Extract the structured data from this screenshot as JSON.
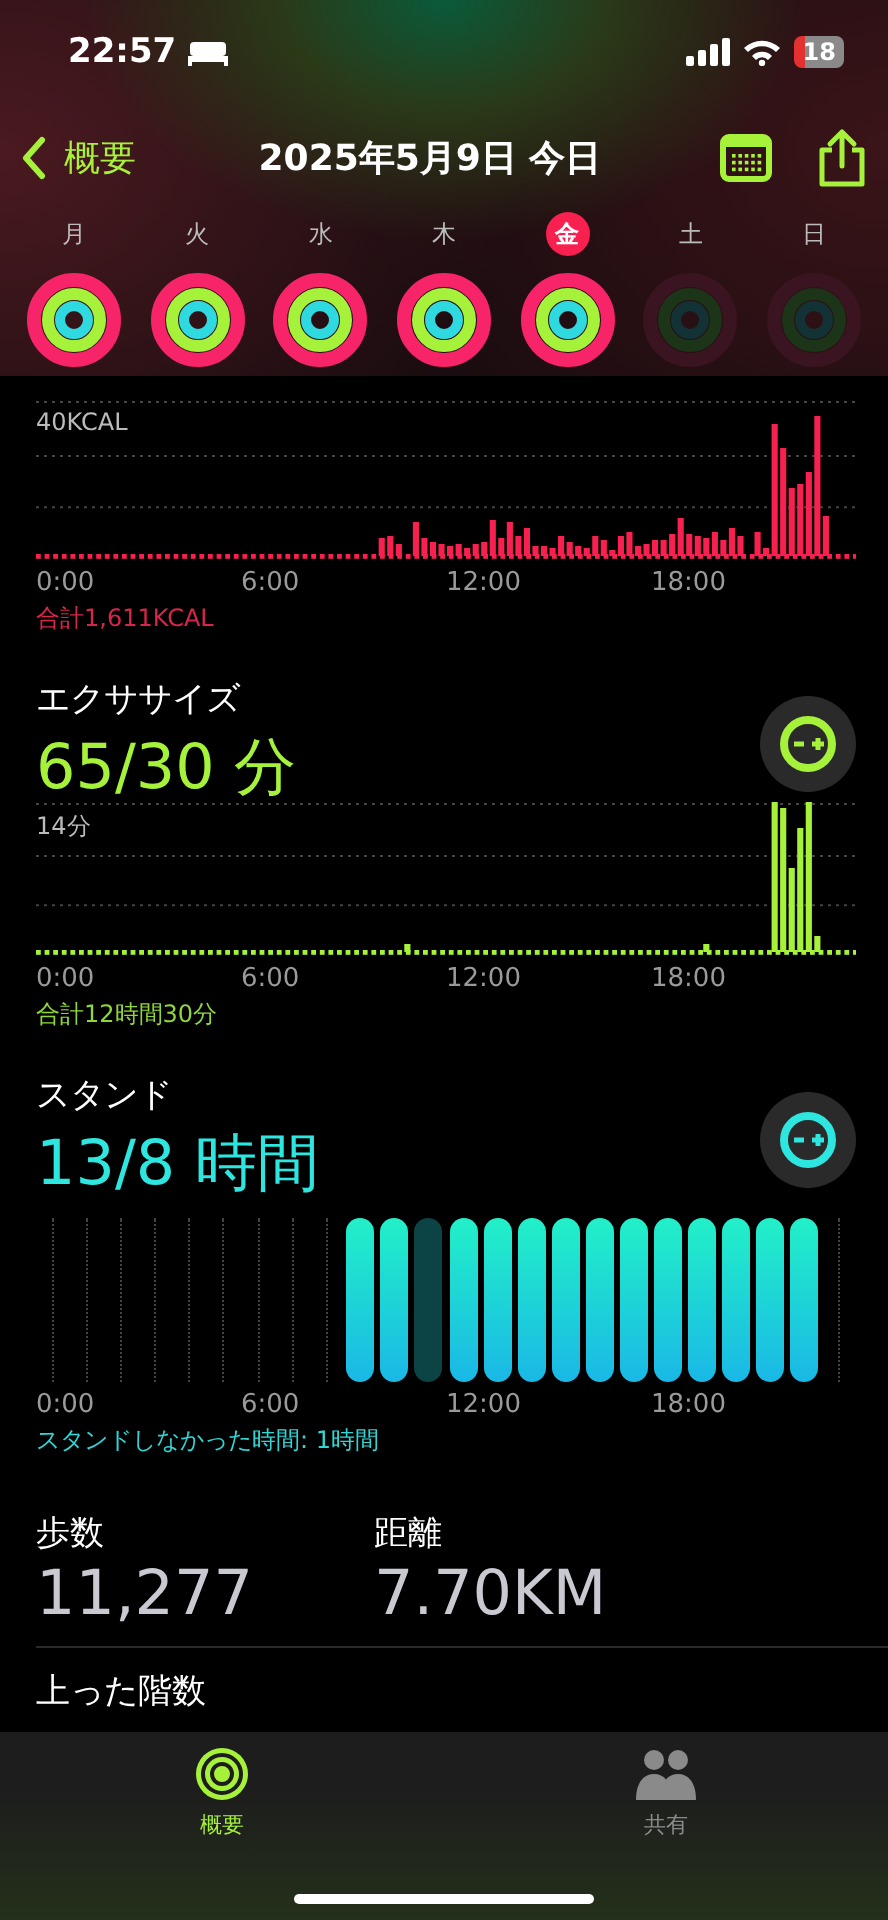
{
  "status_bar": {
    "time": "22:57",
    "battery": "18"
  },
  "nav": {
    "back": "概要",
    "title": "2025年5月9日 今日"
  },
  "days": [
    {
      "label": "月",
      "selected": false,
      "active": true
    },
    {
      "label": "火",
      "selected": false,
      "active": true
    },
    {
      "label": "水",
      "selected": false,
      "active": true
    },
    {
      "label": "木",
      "selected": false,
      "active": true
    },
    {
      "label": "金",
      "selected": true,
      "active": true
    },
    {
      "label": "土",
      "selected": false,
      "active": false
    },
    {
      "label": "日",
      "selected": false,
      "active": false
    }
  ],
  "move": {
    "y_label": "40KCAL",
    "x_labels": [
      "0:00",
      "6:00",
      "12:00",
      "18:00"
    ],
    "total": "合計1,611KCAL"
  },
  "exercise": {
    "title": "エクササイズ",
    "value": "65/30 分",
    "y_label": "14分",
    "x_labels": [
      "0:00",
      "6:00",
      "12:00",
      "18:00"
    ],
    "total": "合計12時間30分"
  },
  "stand": {
    "title": "スタンド",
    "value": "13/8 時間",
    "x_labels": [
      "0:00",
      "6:00",
      "12:00",
      "18:00"
    ],
    "caption": "スタンドしなかった時間: 1時間",
    "hours": [
      {
        "kind": "empty"
      },
      {
        "kind": "empty"
      },
      {
        "kind": "empty"
      },
      {
        "kind": "empty"
      },
      {
        "kind": "empty"
      },
      {
        "kind": "empty"
      },
      {
        "kind": "empty"
      },
      {
        "kind": "empty"
      },
      {
        "kind": "empty"
      },
      {
        "kind": "stood"
      },
      {
        "kind": "stood"
      },
      {
        "kind": "missed"
      },
      {
        "kind": "stood"
      },
      {
        "kind": "stood"
      },
      {
        "kind": "stood"
      },
      {
        "kind": "stood"
      },
      {
        "kind": "stood"
      },
      {
        "kind": "stood"
      },
      {
        "kind": "stood"
      },
      {
        "kind": "stood"
      },
      {
        "kind": "stood"
      },
      {
        "kind": "stood"
      },
      {
        "kind": "stood"
      },
      {
        "kind": "empty"
      }
    ]
  },
  "stats": [
    {
      "label": "歩数",
      "value": "11,277"
    },
    {
      "label": "距離",
      "value": "7.70KM"
    }
  ],
  "next_section": {
    "title": "上った階数"
  },
  "tabs": [
    {
      "label": "概要",
      "selected": true
    },
    {
      "label": "共有",
      "selected": false
    }
  ]
}
